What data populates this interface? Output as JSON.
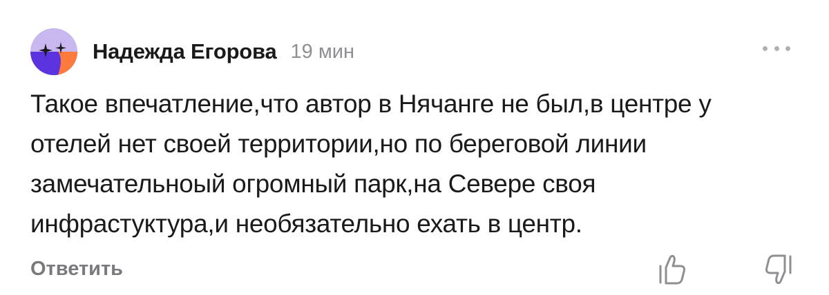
{
  "comment": {
    "author": "Надежда Егорова",
    "time": "19 мин",
    "text_lines": [
      "Такое впечатление,что автор в Нячанге не был,в центре у",
      "отелей нет своей территории,но по береговой линии",
      "замечательноый огромный парк,на Севере своя",
      "инфрастуктура,и необязательно ехать в центр."
    ],
    "reply_label": "Ответить"
  },
  "icons": {
    "avatar": "avatar-logo-icon",
    "more": "more-dots-icon",
    "like": "thumbs-up-icon",
    "dislike": "thumbs-down-icon"
  },
  "colors": {
    "avatar_purple": "#5b34e0",
    "avatar_lilac": "#c8b8ef",
    "avatar_orange": "#ff7a3d",
    "text": "#1a1a1a",
    "muted": "#8e8e93"
  }
}
